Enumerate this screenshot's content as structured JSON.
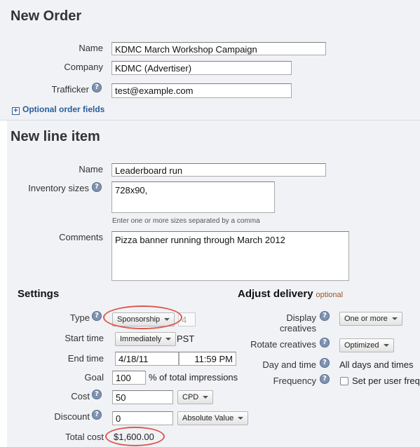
{
  "order": {
    "title": "New Order",
    "name_label": "Name",
    "name_value": "KDMC March Workshop Campaign",
    "company_label": "Company",
    "company_value": "KDMC (Advertiser)",
    "trafficker_label": "Trafficker",
    "trafficker_value": "test@example.com",
    "optional_fields_link": "Optional order fields"
  },
  "line_item": {
    "title": "New line item",
    "name_label": "Name",
    "name_value": "Leaderboard run",
    "inventory_label": "Inventory sizes",
    "inventory_value": "728x90,",
    "inventory_hint": "Enter one or more sizes separated by a comma",
    "comments_label": "Comments",
    "comments_value": "Pizza banner running through March 2012"
  },
  "settings": {
    "title": "Settings",
    "type_label": "Type",
    "type_value": "Sponsorship",
    "type_number": "4",
    "start_label": "Start time",
    "start_value": "Immediately",
    "timezone": "PST",
    "end_label": "End time",
    "end_date": "4/18/11",
    "end_time": "11:59 PM",
    "goal_label": "Goal",
    "goal_value": "100",
    "goal_suffix": "% of total impressions",
    "cost_label": "Cost",
    "cost_value": "50",
    "cost_type": "CPD",
    "discount_label": "Discount",
    "discount_value": "0",
    "discount_type": "Absolute Value",
    "total_label": "Total cost",
    "total_value": "$1,600.00"
  },
  "delivery": {
    "title": "Adjust delivery",
    "optional_note": "optional",
    "display_label_1": "Display",
    "display_label_2": "creatives",
    "display_value": "One or more",
    "rotate_label": "Rotate creatives",
    "rotate_value": "Optimized",
    "daytime_label": "Day and time",
    "daytime_value": "All days and times",
    "frequency_label": "Frequency",
    "frequency_value": "Set per user freq"
  },
  "icons": {
    "help": "question-mark-icon",
    "expand": "plus-box-icon",
    "dropdown": "caret-down-icon"
  },
  "colors": {
    "panel_bg": "#f0f2f5",
    "link": "#2a5e9c",
    "highlight_ring": "#e0564d",
    "optional_note": "#a0521e"
  }
}
